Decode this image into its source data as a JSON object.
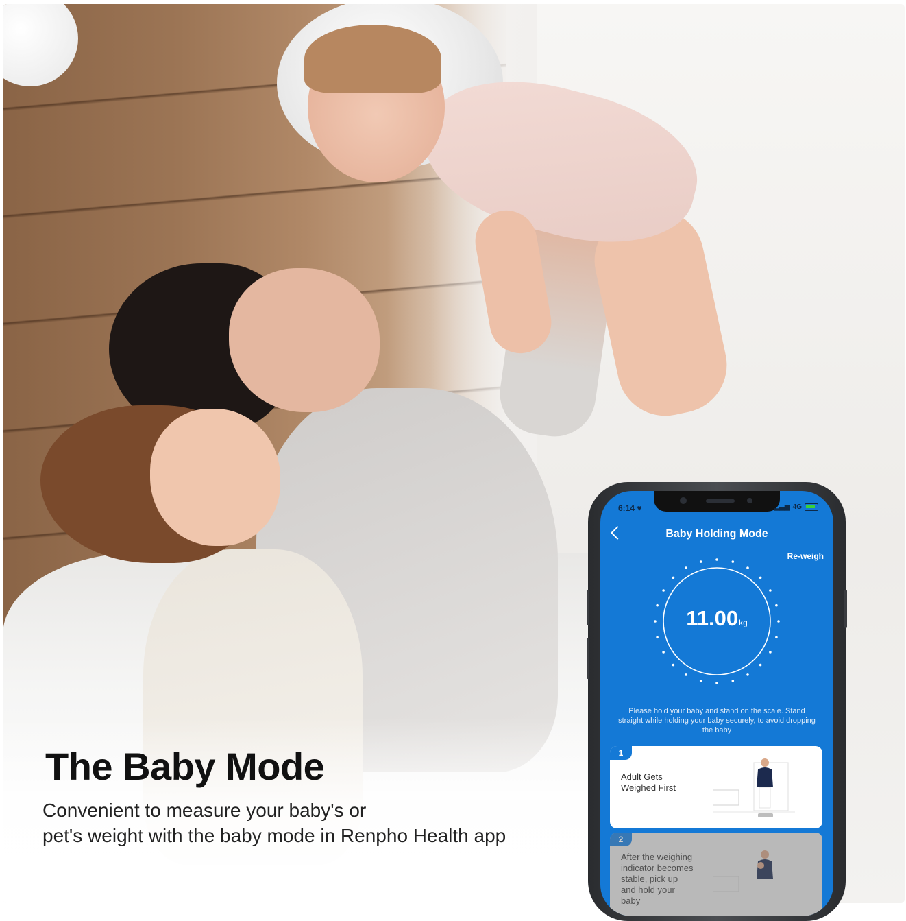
{
  "headline": "The Baby Mode",
  "subline": {
    "line1": "Convenient to measure your baby's or",
    "line2": "pet's weight with the baby mode in Renpho Health app"
  },
  "phone": {
    "status": {
      "time": "6:14 ♥",
      "network": "4G"
    },
    "nav": {
      "title": "Baby Holding Mode",
      "back_icon": "chevron-left-icon"
    },
    "reweigh_label": "Re-weigh",
    "reading": {
      "value": "11.00",
      "unit": "kg"
    },
    "instruction": "Please hold your baby and stand on the scale. Stand straight while holding your baby securely, to avoid dropping the baby",
    "steps": [
      {
        "number": "1",
        "text": "Adult Gets\nWeighed First"
      },
      {
        "number": "2",
        "text": "After the weighing\nindicator becomes\nstable, pick up\nand hold your\nbaby"
      }
    ]
  },
  "colors": {
    "app_blue": "#1479d6",
    "text_dark": "#111111"
  }
}
